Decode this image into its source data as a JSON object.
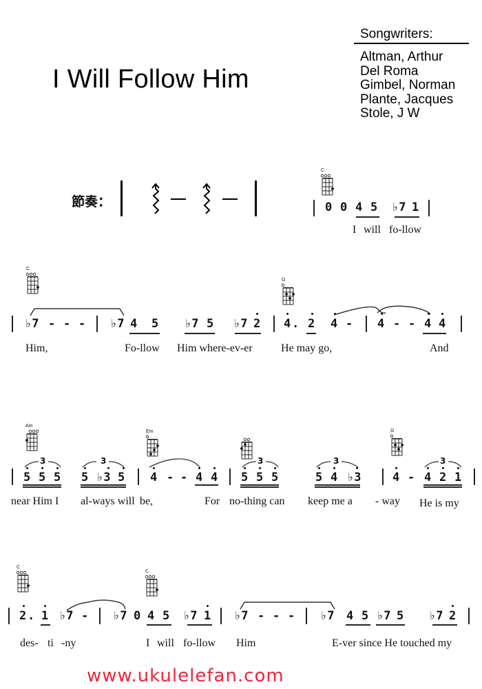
{
  "song": {
    "title": "I Will Follow Him",
    "songwriters_label": "Songwriters:",
    "songwriters": [
      "Altman, Arthur",
      "Del Roma",
      "Gimbel, Norman",
      "Plante, Jacques",
      "Stole, J W"
    ]
  },
  "rhythm": {
    "label": "節奏：",
    "pattern": [
      "strum-up-icon",
      "rest-dash",
      "strum-up-icon",
      "rest-dash"
    ]
  },
  "chords": {
    "c1": "C",
    "c2": "C",
    "g1": "G",
    "am": "Am",
    "em": "Em",
    "c_blank": "",
    "g2": "G",
    "c3": "C",
    "c4": "C"
  },
  "line1": {
    "notes": [
      "0",
      "0",
      "4",
      "5",
      "♭7",
      "1"
    ],
    "lyrics": [
      "I",
      "will",
      "fo-llow"
    ]
  },
  "line2": {
    "notes": [
      "♭7",
      "-",
      "-",
      "-",
      "♭7",
      "4",
      "5",
      "♭7",
      "5",
      "♭7",
      "2",
      "4",
      ".",
      "2",
      "4",
      "-",
      "4",
      "-",
      "-",
      "4",
      "4"
    ],
    "lyrics": [
      "Him,",
      "Fo-llow",
      "Him where-ev-er",
      "He may go,",
      "And"
    ]
  },
  "line3": {
    "triplet": "3",
    "notes": [
      "5",
      "5",
      "5",
      "5",
      "♭3",
      "5",
      "4",
      "-",
      "-",
      "4",
      "4",
      "5",
      "5",
      "5",
      "5",
      "4",
      "♭3",
      "4",
      "-",
      "4",
      "2",
      "1"
    ],
    "lyrics": [
      "near Him I",
      "al-ways will",
      "be,",
      "For",
      "no-thing can",
      "keep me a",
      "- way",
      "He is my"
    ]
  },
  "line4": {
    "notes": [
      "2",
      ".",
      "1",
      "♭7",
      "-",
      "♭7",
      "0",
      "4",
      "5",
      "♭7",
      "1",
      "♭7",
      "-",
      "-",
      "-",
      "♭7",
      "4",
      "5",
      "♭7",
      "5",
      "♭7",
      "2"
    ],
    "lyrics": [
      "des-",
      "ti",
      "-ny",
      "I",
      "will",
      "fo-llow",
      "Him",
      "E-ver since He touched my"
    ]
  },
  "footer": {
    "website": "www.ukulelefan.com"
  },
  "colors": {
    "website": "#f0243c",
    "ink": "#111111"
  }
}
